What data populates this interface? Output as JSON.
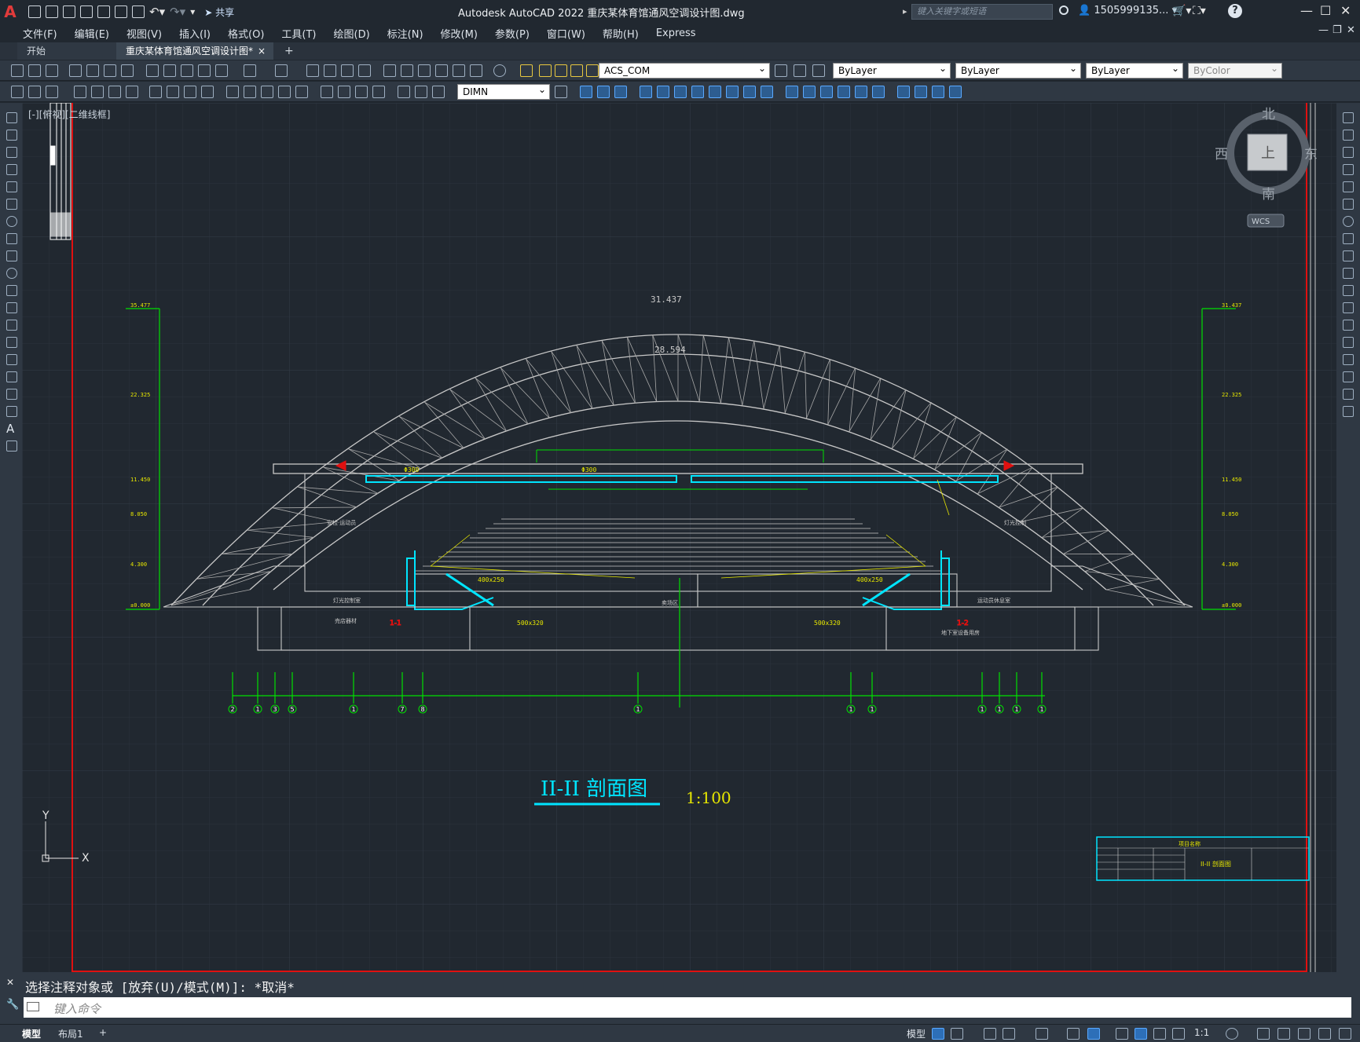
{
  "app": {
    "window_title": "Autodesk AutoCAD 2022    重庆某体育馆通风空调设计图.dwg",
    "share_label": "共享",
    "search_placeholder": "键入关键字或短语",
    "user_label": "1505999135...",
    "help_label": "?"
  },
  "menu": [
    "文件(F)",
    "编辑(E)",
    "视图(V)",
    "插入(I)",
    "格式(O)",
    "工具(T)",
    "绘图(D)",
    "标注(N)",
    "修改(M)",
    "参数(P)",
    "窗口(W)",
    "帮助(H)",
    "Express"
  ],
  "tabs": {
    "start": "开始",
    "doc": "重庆某体育馆通风空调设计图*",
    "close": "×",
    "add": "+"
  },
  "toolbar": {
    "layer": "ACS_COM",
    "color": "ByLayer",
    "linetype": "ByLayer",
    "lineweight": "ByLayer",
    "plotstyle": "ByColor",
    "dimstyle": "DIMN"
  },
  "viewport": {
    "label": "[-][俯视][二维线框]",
    "viewcube": {
      "north": "北",
      "south": "南",
      "east": "东",
      "west": "西",
      "top": "上",
      "wcs": "WCS"
    },
    "ucs": {
      "x": "X",
      "y": "Y"
    }
  },
  "drawing": {
    "title": "II-II 剖面图",
    "scale": "1:100",
    "elev_top": "31.437",
    "elev_inner": "28.594",
    "left_dims": [
      "35.477",
      "22.325",
      "11.450",
      "8.050",
      "4.300",
      "±0.000"
    ],
    "right_dims": [
      "31.437",
      "22.325",
      "11.450",
      "8.050",
      "4.300",
      "±0.000"
    ],
    "axis_labels": [
      "2",
      "1",
      "3",
      "5",
      "1",
      "7",
      "8",
      "1",
      "1",
      "1",
      "1",
      "1",
      "1",
      "1"
    ],
    "duct_labels": [
      "500x320",
      "400x250",
      "500x320",
      "400x250",
      "Φ300",
      "Φ300"
    ],
    "room_labels": [
      "安检·运动员",
      "灯光控制室",
      "灯光控制",
      "売店器材",
      "卖场区",
      "地下室设备用房",
      "运动员休息室"
    ],
    "section_marks": [
      "1-1",
      "1-2"
    ],
    "titleblock": {
      "project": "项目名称",
      "drawing_name": "II-II 剖面图"
    }
  },
  "command": {
    "history": "选择注释对象或 [放弃(U)/模式(M)]: *取消*",
    "placeholder": "键入命令"
  },
  "status": {
    "model_tab": "模型",
    "layout_tab": "布局1",
    "add_tab": "+",
    "model_btn": "模型",
    "scale": "1:1"
  },
  "colors": {
    "canvas": "#212830",
    "structure": "#c8c8c8",
    "green": "#00e000",
    "cyan": "#00e5ff",
    "yellow": "#e6e600",
    "red": "#e01010",
    "panel": "#2f3843"
  }
}
